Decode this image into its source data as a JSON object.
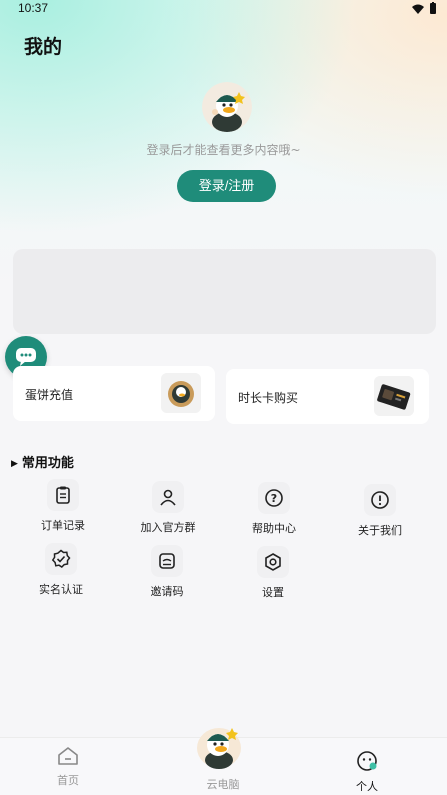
{
  "status_bar": {
    "time": "10:37"
  },
  "header": {
    "title": "我的"
  },
  "login": {
    "hint": "登录后才能查看更多内容哦~",
    "button_label": "登录/注册"
  },
  "cards": {
    "recharge_label": "蛋饼充值",
    "time_card_label": "时长卡购买"
  },
  "functions": {
    "section_title": "常用功能",
    "items": [
      {
        "label": "订单记录",
        "icon": "clipboard-icon"
      },
      {
        "label": "加入官方群",
        "icon": "person-icon"
      },
      {
        "label": "帮助中心",
        "icon": "question-circle-icon"
      },
      {
        "label": "关于我们",
        "icon": "info-circle-icon"
      },
      {
        "label": "实名认证",
        "icon": "verified-badge-icon"
      },
      {
        "label": "邀请码",
        "icon": "invite-card-icon"
      },
      {
        "label": "设置",
        "icon": "settings-hexagon-icon"
      }
    ]
  },
  "bottom_nav": {
    "home_label": "首页",
    "cloud_pc_label": "云电脑",
    "profile_label": "个人"
  },
  "colors": {
    "primary": "#1f8c7a",
    "background": "#f6f6f8",
    "muted_text": "#9a9a9a"
  }
}
